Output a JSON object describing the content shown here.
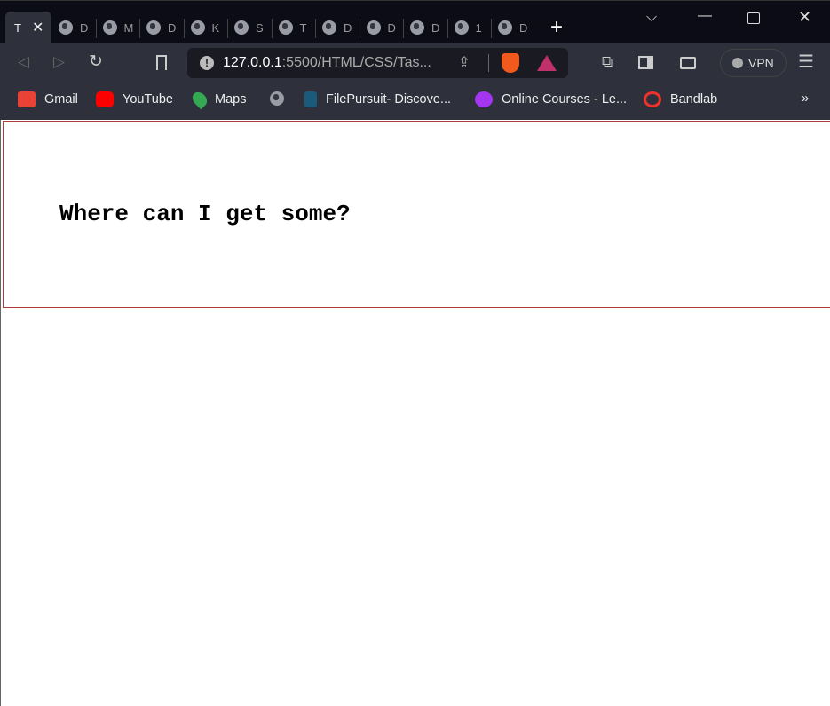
{
  "tabs": [
    {
      "label": "T",
      "active": true
    },
    {
      "label": "D"
    },
    {
      "label": "M"
    },
    {
      "label": "D"
    },
    {
      "label": "K"
    },
    {
      "label": "S"
    },
    {
      "label": "T"
    },
    {
      "label": "D"
    },
    {
      "label": "D"
    },
    {
      "label": "D"
    },
    {
      "label": "1"
    },
    {
      "label": "D"
    }
  ],
  "url": {
    "host": "127.0.0.1",
    "path": ":5500/HTML/CSS/Tas..."
  },
  "vpn_label": "VPN",
  "bookmarks": [
    {
      "label": "Gmail",
      "color": "#ea4335"
    },
    {
      "label": "YouTube",
      "color": "#ff0000"
    },
    {
      "label": "Maps",
      "color": "#34a853"
    },
    {
      "label": "",
      "color": "#9a9ca5"
    },
    {
      "label": "FilePursuit- Discove...",
      "color": "#1a5a7a"
    },
    {
      "label": "Online Courses - Le...",
      "color": "#a435f0"
    },
    {
      "label": "Bandlab",
      "color": "#f0302a"
    }
  ],
  "overflow": "»",
  "page": {
    "heading": "Where can I get some?"
  }
}
